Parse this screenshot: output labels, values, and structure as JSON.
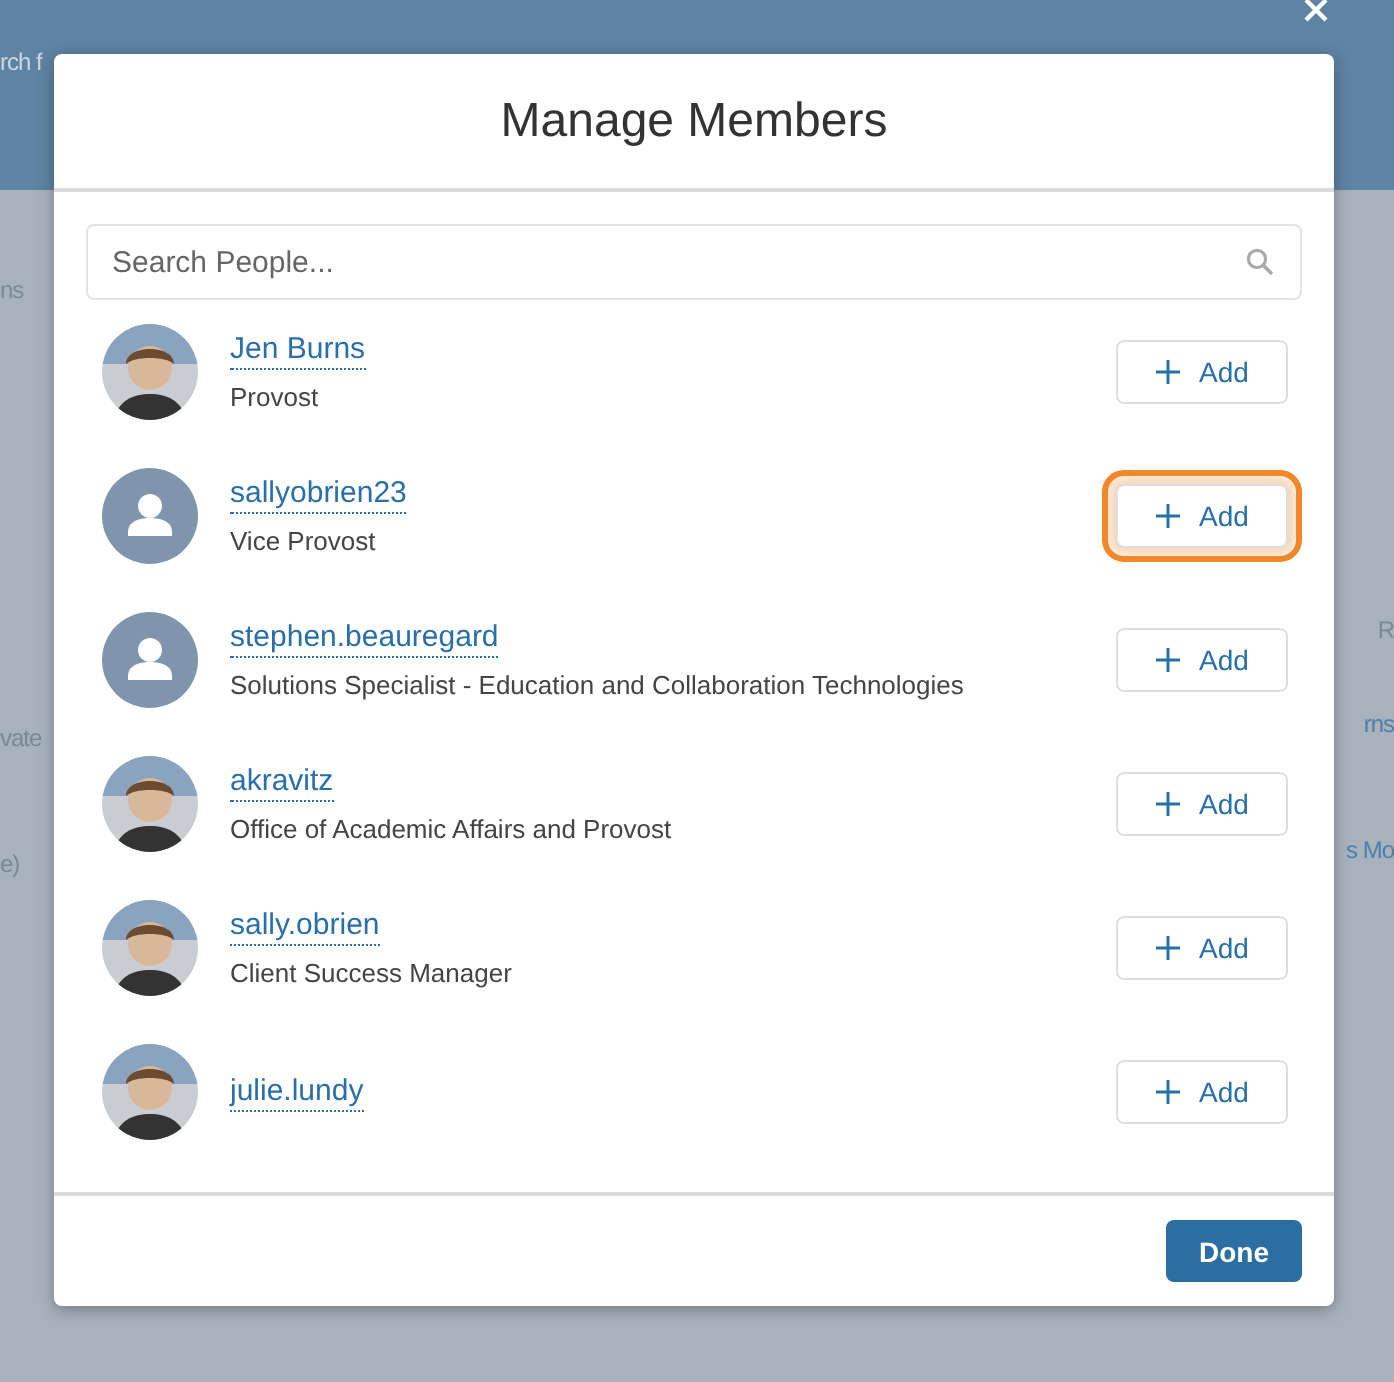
{
  "background": {
    "left_fragments": [
      "rch f",
      "ns",
      "vate",
      "e)"
    ],
    "right_fragments": [
      "R",
      "rns",
      "s Mo"
    ]
  },
  "dialog": {
    "title": "Manage Members",
    "search": {
      "placeholder": "Search People..."
    },
    "people": [
      {
        "name": "Jen Burns",
        "role": "Provost",
        "action": "Add",
        "highlighted": false
      },
      {
        "name": "sallyobrien23",
        "role": "Vice Provost",
        "kind": "placeholder",
        "action": "Add",
        "highlighted": true
      },
      {
        "name": "stephen.beauregard",
        "role": "Solutions Specialist - Education and Collaboration Technologies",
        "kind": "placeholder",
        "action": "Add",
        "highlighted": false
      },
      {
        "name": "akravitz",
        "role": "Office of Academic Affairs and Provost",
        "action": "Add",
        "highlighted": false
      },
      {
        "name": "sally.obrien",
        "role": "Client Success Manager",
        "action": "Add",
        "highlighted": false
      },
      {
        "name": "julie.lundy",
        "action": "Add",
        "highlighted": false
      }
    ],
    "done": "Done"
  }
}
